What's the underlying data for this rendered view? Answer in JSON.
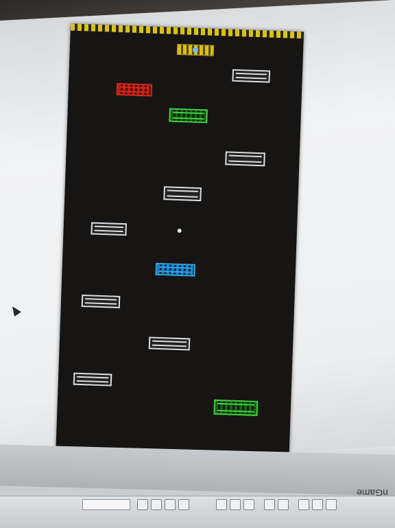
{
  "app": {
    "title": "nGame"
  },
  "game": {
    "hazard_strip": "hazard-stripe",
    "player_paddle": "paddle",
    "bricks": [
      {
        "color": "white",
        "name": "brick-white-1"
      },
      {
        "color": "red",
        "name": "brick-red-1"
      },
      {
        "color": "green",
        "name": "brick-green-1"
      },
      {
        "color": "white",
        "name": "brick-white-2"
      },
      {
        "color": "white",
        "name": "brick-white-3"
      },
      {
        "color": "white",
        "name": "brick-white-4"
      },
      {
        "color": "blue",
        "name": "brick-blue-1"
      },
      {
        "color": "white",
        "name": "brick-white-5"
      },
      {
        "color": "white",
        "name": "brick-white-6"
      },
      {
        "color": "white",
        "name": "brick-white-7"
      },
      {
        "color": "green",
        "name": "brick-green-2"
      }
    ],
    "colors": {
      "background": "#161513",
      "hazard": "#d9c21a",
      "white_brick": "#d9dde2",
      "red_brick": "#d32a1d",
      "green_brick": "#3cd43b",
      "blue_brick": "#2fa4e7",
      "paddle": "#d8bd1c"
    }
  },
  "icons": {
    "cursor": "mouse-cursor-icon",
    "toolbar": [
      "toolbar-icon"
    ]
  }
}
